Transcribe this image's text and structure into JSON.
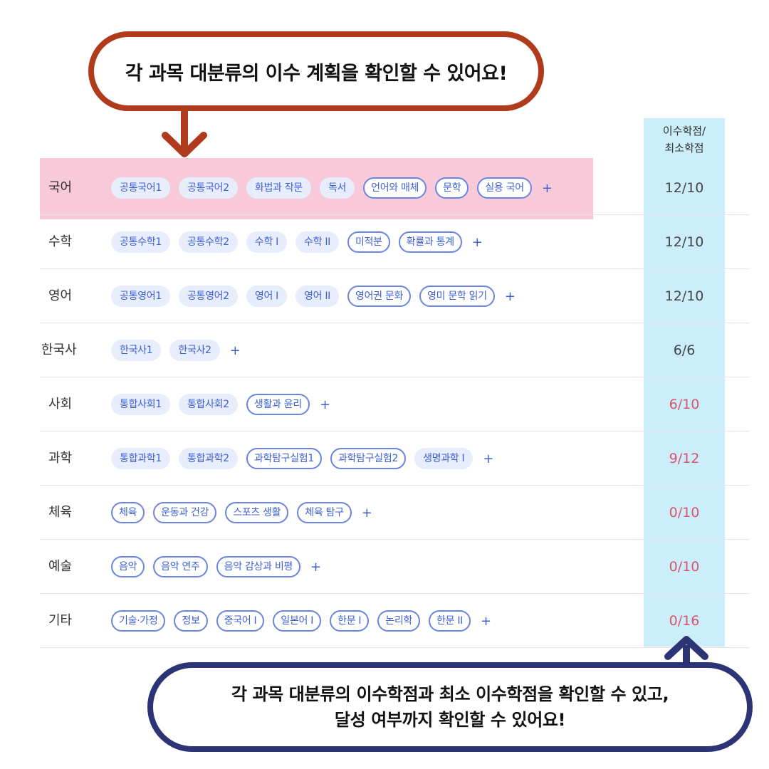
{
  "callout_top": {
    "text": "각 과목 대분류의 이수 계획을 확인할 수 있어요!"
  },
  "table": {
    "credit_header_line1": "이수학점/",
    "credit_header_line2": "최소학점",
    "plus_label": "+",
    "rows": [
      {
        "name": "국어",
        "credits": "12/10",
        "met": true,
        "courses": [
          {
            "label": "공통국어1",
            "style": "filled"
          },
          {
            "label": "공통국어2",
            "style": "filled"
          },
          {
            "label": "화법과 작문",
            "style": "filled"
          },
          {
            "label": "독서",
            "style": "filled"
          },
          {
            "label": "언어와 매체",
            "style": "outline"
          },
          {
            "label": "문학",
            "style": "outline"
          },
          {
            "label": "실용 국어",
            "style": "outline"
          }
        ]
      },
      {
        "name": "수학",
        "credits": "12/10",
        "met": true,
        "courses": [
          {
            "label": "공통수학1",
            "style": "filled"
          },
          {
            "label": "공통수학2",
            "style": "filled"
          },
          {
            "label": "수학 I",
            "style": "filled"
          },
          {
            "label": "수학 II",
            "style": "filled"
          },
          {
            "label": "미적분",
            "style": "outline"
          },
          {
            "label": "확률과 통계",
            "style": "outline"
          }
        ]
      },
      {
        "name": "영어",
        "credits": "12/10",
        "met": true,
        "courses": [
          {
            "label": "공통영어1",
            "style": "filled"
          },
          {
            "label": "공통영어2",
            "style": "filled"
          },
          {
            "label": "영어 I",
            "style": "filled"
          },
          {
            "label": "영어 II",
            "style": "filled"
          },
          {
            "label": "영어권 문화",
            "style": "outline"
          },
          {
            "label": "영미 문학 읽기",
            "style": "outline"
          }
        ]
      },
      {
        "name": "한국사",
        "credits": "6/6",
        "met": true,
        "courses": [
          {
            "label": "한국사1",
            "style": "filled"
          },
          {
            "label": "한국사2",
            "style": "filled"
          }
        ]
      },
      {
        "name": "사회",
        "credits": "6/10",
        "met": false,
        "courses": [
          {
            "label": "통합사회1",
            "style": "filled"
          },
          {
            "label": "통합사회2",
            "style": "filled"
          },
          {
            "label": "생활과 윤리",
            "style": "outline"
          }
        ]
      },
      {
        "name": "과학",
        "credits": "9/12",
        "met": false,
        "courses": [
          {
            "label": "통합과학1",
            "style": "filled"
          },
          {
            "label": "통합과학2",
            "style": "filled"
          },
          {
            "label": "과학탐구실험1",
            "style": "outline"
          },
          {
            "label": "과학탐구실험2",
            "style": "outline"
          },
          {
            "label": "생명과학 I",
            "style": "filled"
          }
        ]
      },
      {
        "name": "체육",
        "credits": "0/10",
        "met": false,
        "courses": [
          {
            "label": "체육",
            "style": "outline"
          },
          {
            "label": "운동과 건강",
            "style": "outline"
          },
          {
            "label": "스포츠 생활",
            "style": "outline"
          },
          {
            "label": "체육 탐구",
            "style": "outline"
          }
        ]
      },
      {
        "name": "예술",
        "credits": "0/10",
        "met": false,
        "courses": [
          {
            "label": "음악",
            "style": "outline"
          },
          {
            "label": "음악 연주",
            "style": "outline"
          },
          {
            "label": "음악 감상과 비평",
            "style": "outline"
          }
        ]
      },
      {
        "name": "기타",
        "credits": "0/16",
        "met": false,
        "courses": [
          {
            "label": "기술·가정",
            "style": "outline"
          },
          {
            "label": "정보",
            "style": "outline"
          },
          {
            "label": "중국어 I",
            "style": "outline"
          },
          {
            "label": "일본어 I",
            "style": "outline"
          },
          {
            "label": "한문 I",
            "style": "outline"
          },
          {
            "label": "논리학",
            "style": "outline"
          },
          {
            "label": "한문 II",
            "style": "outline"
          }
        ]
      }
    ]
  },
  "callout_bottom": {
    "line1": "각 과목 대분류의 이수학점과 최소 이수학점을 확인할 수 있고,",
    "line2": "달성 여부까지 확인할 수 있어요!"
  },
  "colors": {
    "callout_top_border": "#b03a1c",
    "callout_bottom_border": "#2c3476",
    "row_highlight": "#f8cad9",
    "credit_column_highlight": "#cbeefa",
    "chip_text": "#3d5fd6",
    "deficit_text": "#d8566b"
  }
}
